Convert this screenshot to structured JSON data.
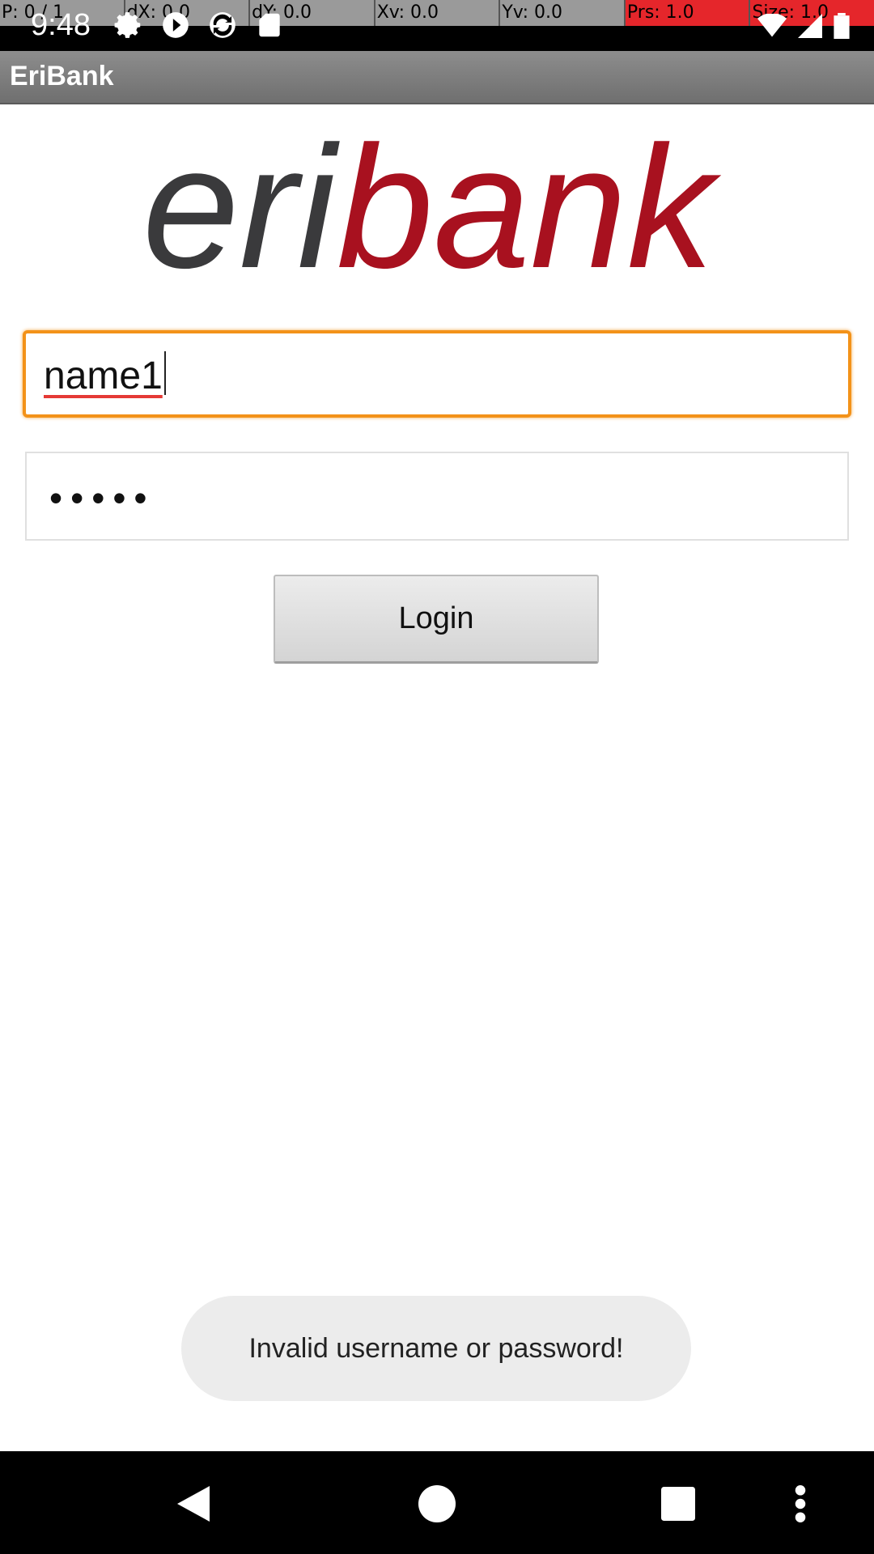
{
  "pointer_bar": [
    "P: 0 / 1",
    "dX: 0.0",
    "dY: 0.0",
    "Xv: 0.0",
    "Yv: 0.0",
    "Prs: 1.0",
    "Size: 1.0"
  ],
  "status_bar": {
    "time": "9:48",
    "left_icons": [
      "settings-icon",
      "play-icon",
      "sync-icon",
      "sd-card-icon"
    ],
    "right_icons": [
      "wifi-icon",
      "signal-icon",
      "battery-icon"
    ]
  },
  "app": {
    "title": "EriBank"
  },
  "logo": {
    "part1": "eri",
    "part2": "bank",
    "color1": "#3a3a3c",
    "color2": "#a8111f"
  },
  "login_form": {
    "username_value": "name1",
    "password_mask": "•••••",
    "login_label": "Login"
  },
  "toast": {
    "message": "Invalid username or password!"
  },
  "nav_bar": {
    "buttons": [
      "back-icon",
      "home-icon",
      "recents-icon",
      "menu-icon"
    ]
  },
  "colors": {
    "focus_orange": "#f39219",
    "action_bar": "#7d7d7d",
    "brand_red": "#a8111f"
  }
}
